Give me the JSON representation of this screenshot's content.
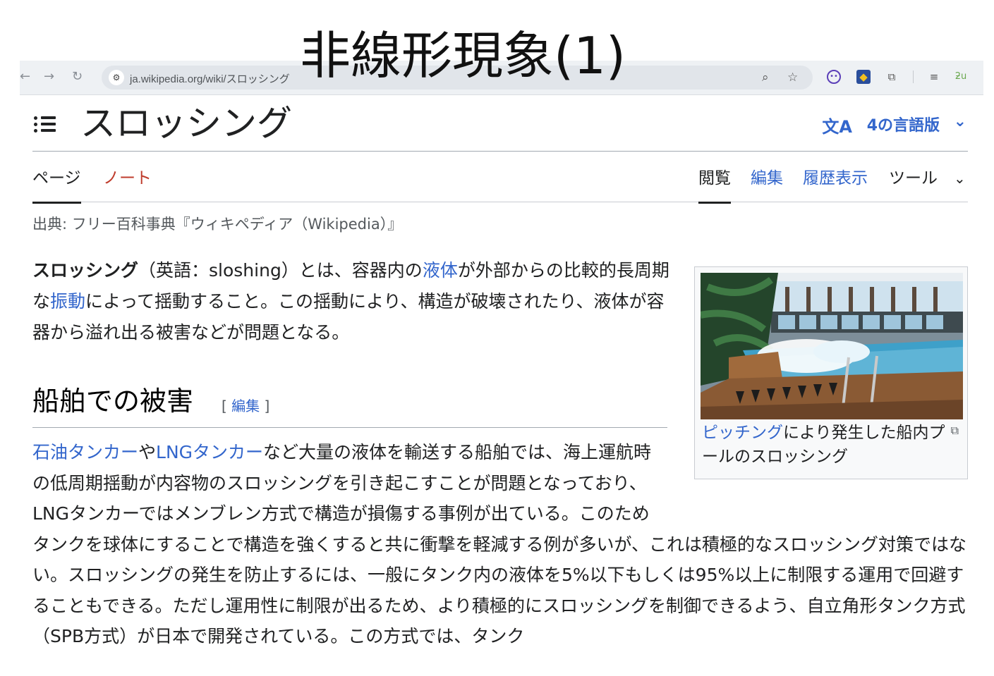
{
  "slide": {
    "title": "非線形現象(1)"
  },
  "browser": {
    "url": "ja.wikipedia.org/wiki/スロッシング",
    "icons": [
      "back-icon",
      "forward-icon",
      "reload-icon",
      "site-info-icon",
      "zoom-icon",
      "bookmark-star-icon",
      "extension-icons",
      "reading-list-icon"
    ],
    "accent": "#eef1f4"
  },
  "header": {
    "title": "スロッシング",
    "language_button": "4の言語版"
  },
  "tabs": {
    "page": "ページ",
    "talk": "ノート",
    "read": "閲覧",
    "edit": "編集",
    "history": "履歴表示",
    "tools": "ツール"
  },
  "source_line": "出典: フリー百科事典『ウィキペディア（Wikipedia）』",
  "lead": {
    "term": "スロッシング",
    "t1": "（英語：sloshing）とは、容器内の",
    "link1": "液体",
    "t2": "が外部からの比較的長周期な",
    "link2": "振動",
    "t3": "によって揺動すること。この揺動により、構造が破壊されたり、液体が容器から溢れ出る被害などが問題となる。"
  },
  "section": {
    "heading": "船舶での被害",
    "edit_open": "[ ",
    "edit_label": "編集",
    "edit_close": " ]"
  },
  "section_body": {
    "link1": "石油タンカー",
    "t1": "や",
    "link2": "LNGタンカー",
    "t2": "など大量の液体を輸送する船舶では、海上運航時の低周期揺動が内容物のスロッシングを引き起こすことが問題となっており、LNGタンカーではメンブレン方式で構造が損傷する事例が出ている。このためタンクを球体にすることで構造を強くすると共に衝撃を軽減する例が多いが、これは積極的なスロッシング対策ではない。スロッシングの発生を防止するには、一般にタンク内の液体を5%以下もしくは95%以上に制限する運用で回避することもできる。ただし運用性に制限が出るため、より積極的にスロッシングを制御できるよう、自立角形タンク方式（SPB方式）が日本で開発されている。この方式では、タンク"
  },
  "thumbnail": {
    "caption_link": "ピッチング",
    "caption_text": "により発生した船内プールのスロッシング",
    "colors": {
      "water": "#5fb4d6",
      "deck": "#8a5a34",
      "sky": "#cfe2ee"
    }
  }
}
